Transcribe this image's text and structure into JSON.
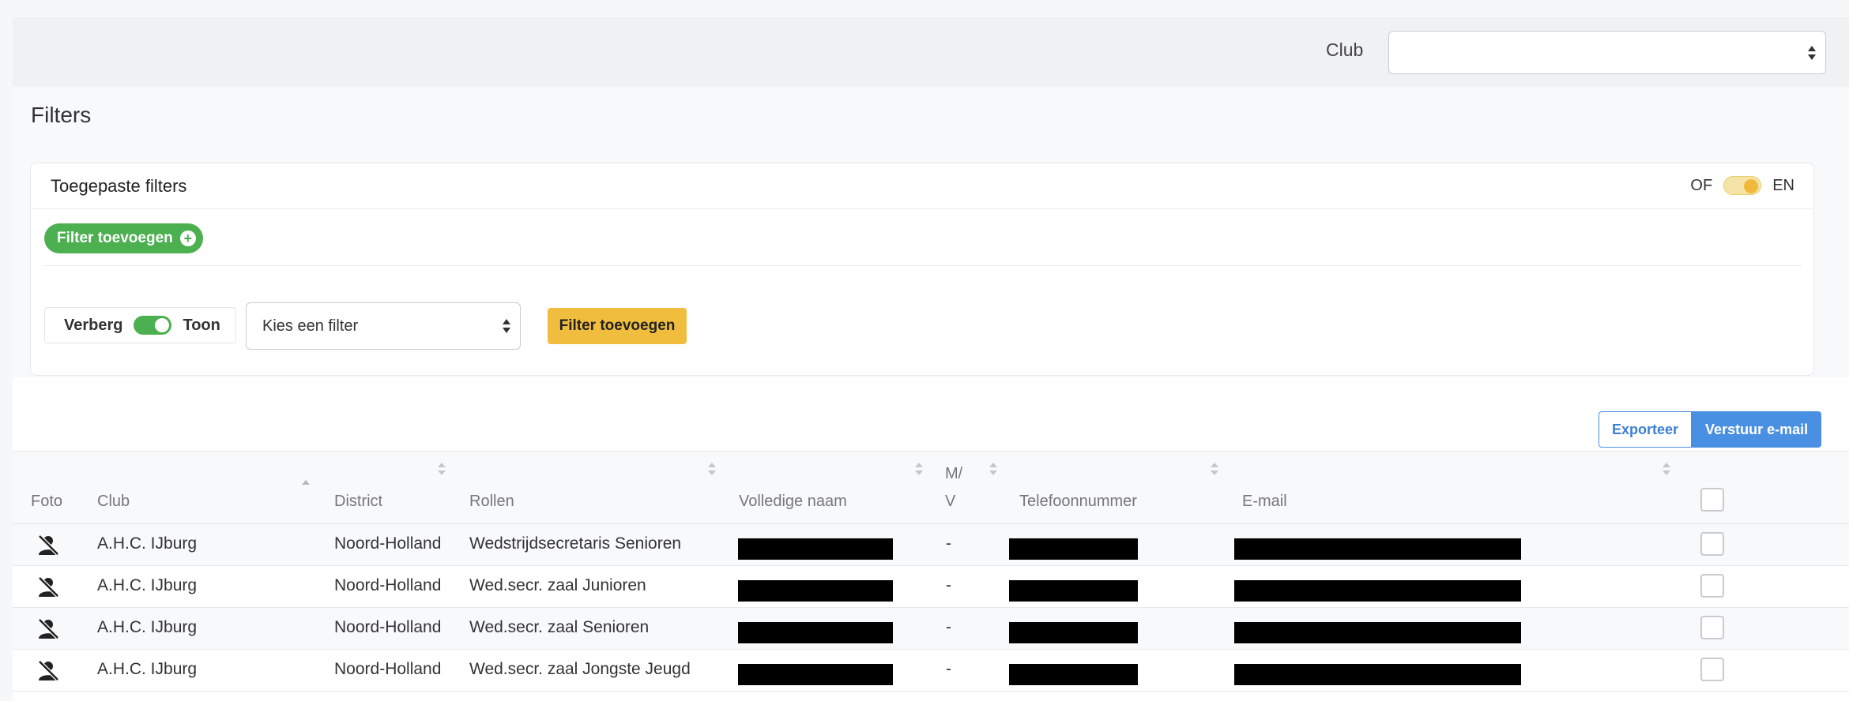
{
  "topbar": {
    "club_label": "Club",
    "club_value": ""
  },
  "filters": {
    "title": "Filters",
    "applied_title": "Toegepaste filters",
    "or_label": "OF",
    "and_label": "EN",
    "add_pill_label": "Filter toevoegen",
    "hide_label": "Verberg",
    "show_label": "Toon",
    "filter_select_value": "Kies een filter",
    "add_button_label": "Filter toevoegen"
  },
  "actions": {
    "export_label": "Exporteer",
    "email_label": "Verstuur e-mail"
  },
  "table": {
    "columns": {
      "foto": "Foto",
      "club": "Club",
      "district": "District",
      "rollen": "Rollen",
      "naam": "Volledige naam",
      "mv_line1": "M/",
      "mv_line2": "V",
      "telefoon": "Telefoonnummer",
      "email": "E-mail"
    },
    "rows": [
      {
        "club": "A.H.C. IJburg",
        "district": "Noord-Holland",
        "rol": "Wedstrijdsecretaris Senioren",
        "mv": "-"
      },
      {
        "club": "A.H.C. IJburg",
        "district": "Noord-Holland",
        "rol": "Wed.secr. zaal Junioren",
        "mv": "-"
      },
      {
        "club": "A.H.C. IJburg",
        "district": "Noord-Holland",
        "rol": "Wed.secr. zaal Senioren",
        "mv": "-"
      },
      {
        "club": "A.H.C. IJburg",
        "district": "Noord-Holland",
        "rol": "Wed.secr. zaal Jongste Jeugd",
        "mv": "-"
      }
    ]
  },
  "colors": {
    "green": "#4caf50",
    "yellow": "#f0bd3f",
    "blue": "#4a90e2"
  },
  "icons": {
    "photo_placeholder": "user-slash-icon"
  }
}
